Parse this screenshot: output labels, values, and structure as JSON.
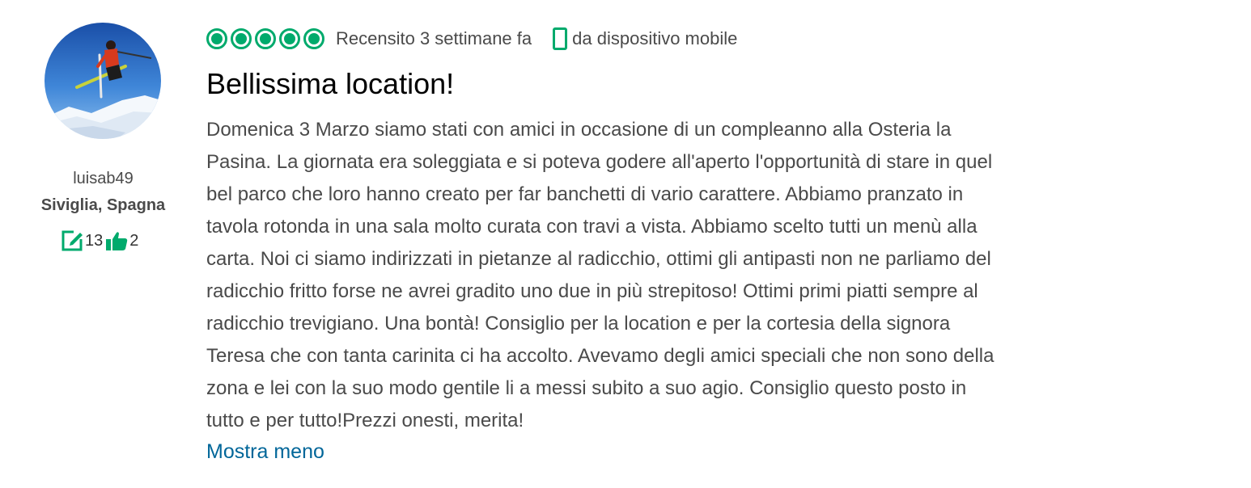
{
  "member": {
    "username": "luisab49",
    "hometown": "Siviglia, Spagna",
    "reviews_icon": "pencil-review-icon",
    "reviews_count": "13",
    "votes_icon": "thumbs-up-icon",
    "votes_count": "2"
  },
  "review": {
    "rating": 5,
    "rating_max": 5,
    "date_text": "Recensito 3 settimane fa",
    "device_icon": "mobile-device-icon",
    "device_text": "da dispositivo mobile",
    "title": "Bellissima location!",
    "body_lines": [
      "Domenica 3 Marzo siamo stati con amici in occasione di un compleanno alla Osteria la",
      "Pasina. La giornata era soleggiata e si poteva godere all'aperto l'opportunità di stare in quel",
      "bel parco che loro hanno creato per far banchetti di vario carattere. Abbiamo pranzato in",
      "tavola rotonda in una sala molto curata con travi a vista. Abbiamo scelto tutti un menù alla",
      "carta. Noi ci siamo indirizzati in pietanze al radicchio, ottimi gli antipasti non ne parliamo del",
      "radicchio fritto forse ne avrei gradito uno due in più strepitoso! Ottimi primi piatti sempre al",
      "radicchio trevigiano. Una bontà! Consiglio per la location e per la cortesia della signora",
      "Teresa che con tanta carinita ci ha accolto. Avevamo degli amici speciali che non sono della",
      "zona e lei con la suo modo gentile li a messi subito a suo agio. Consiglio questo posto in",
      "tutto e per tutto!Prezzi onesti, merita!"
    ],
    "show_less_label": "Mostra meno"
  },
  "colors": {
    "brand_green": "#00aa6c",
    "link_blue": "#006699",
    "text_gray": "#4a4a4a"
  }
}
